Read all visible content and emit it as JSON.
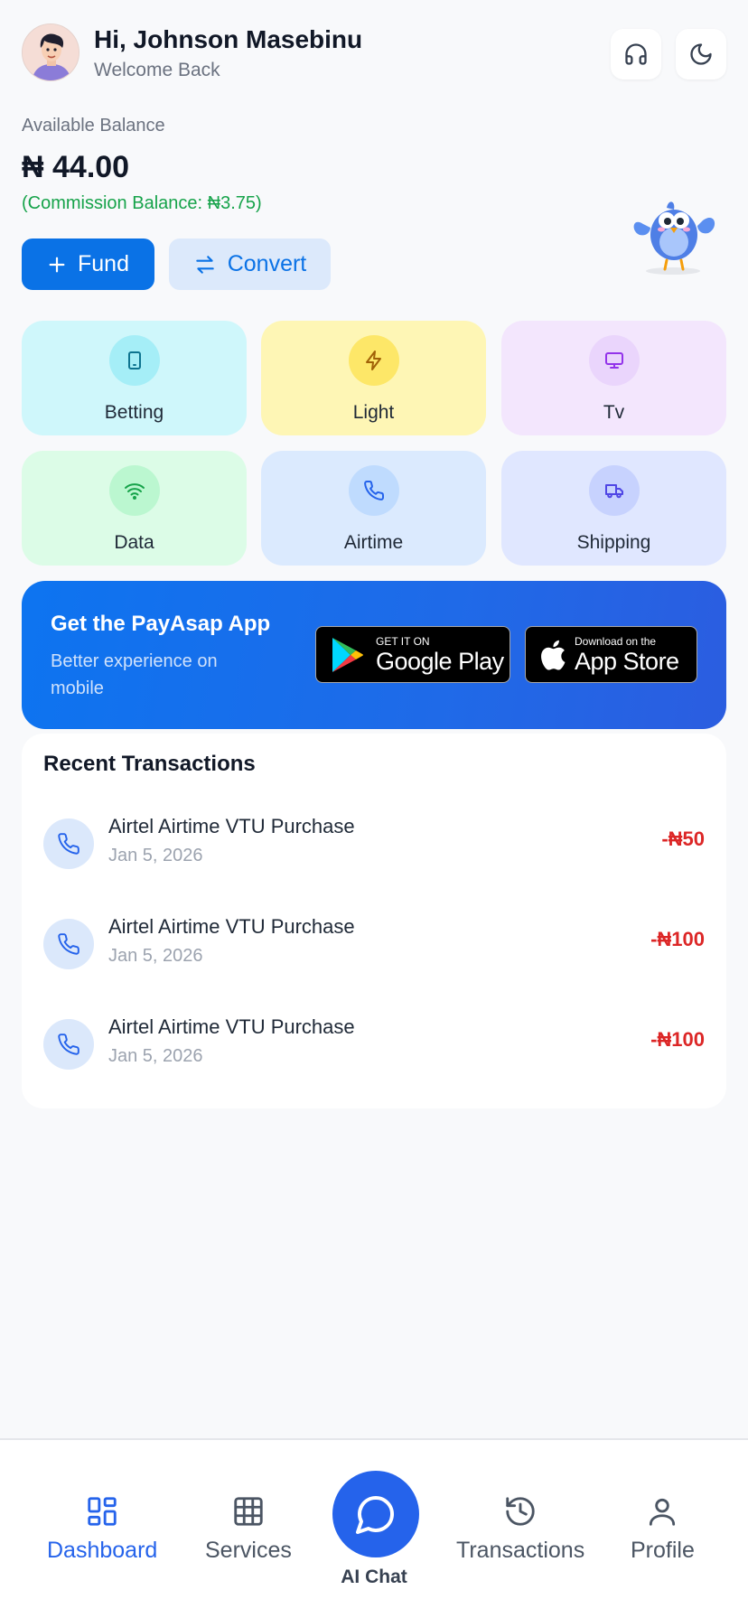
{
  "header": {
    "greeting": "Hi, Johnson Masebinu",
    "subtitle": "Welcome Back"
  },
  "balance": {
    "label": "Available Balance",
    "amount": "₦ 44.00",
    "commission": "(Commission Balance: ₦3.75)"
  },
  "actions": {
    "fund_label": "Fund",
    "convert_label": "Convert"
  },
  "services": [
    {
      "label": "Betting",
      "icon": "tablet-icon",
      "bg": "#cff7fb",
      "icon_bg": "#a5eef7",
      "color": "#0e7490"
    },
    {
      "label": "Light",
      "icon": "lightning-icon",
      "bg": "#fef6b5",
      "icon_bg": "#fde768",
      "color": "#a16207"
    },
    {
      "label": "Tv",
      "icon": "monitor-icon",
      "bg": "#f3e6fd",
      "icon_bg": "#ead5fc",
      "color": "#9333ea"
    },
    {
      "label": "Data",
      "icon": "wifi-icon",
      "bg": "#dcfce7",
      "icon_bg": "#bbf7d0",
      "color": "#16a34a"
    },
    {
      "label": "Airtime",
      "icon": "phone-icon",
      "bg": "#dbeafe",
      "icon_bg": "#bfdbfe",
      "color": "#2563eb"
    },
    {
      "label": "Shipping",
      "icon": "truck-icon",
      "bg": "#e0e7ff",
      "icon_bg": "#c7d2fe",
      "color": "#4f46e5"
    }
  ],
  "banner": {
    "title": "Get the PayAsap App",
    "subtitle": "Better experience on mobile",
    "google_small": "GET IT ON",
    "google_big": "Google Play",
    "apple_small": "Download on the",
    "apple_big": "App Store"
  },
  "recent": {
    "title": "Recent Transactions",
    "items": [
      {
        "title": "Airtel Airtime VTU Purchase",
        "date": "Jan 5, 2026",
        "amount": "-₦50"
      },
      {
        "title": "Airtel Airtime VTU Purchase",
        "date": "Jan 5, 2026",
        "amount": "-₦100"
      },
      {
        "title": "Airtel Airtime VTU Purchase",
        "date": "Jan 5, 2026",
        "amount": "-₦100"
      }
    ]
  },
  "nav": {
    "dashboard": "Dashboard",
    "services": "Services",
    "ai_chat": "AI Chat",
    "transactions": "Transactions",
    "profile": "Profile"
  },
  "colors": {
    "accent": "#0a72e6",
    "success": "#16a34a",
    "debit": "#dc2626"
  }
}
